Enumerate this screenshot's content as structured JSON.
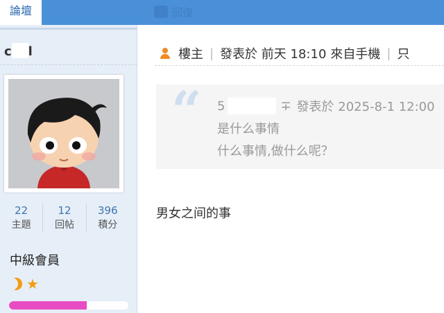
{
  "nav": {
    "forum_tab": "論壇",
    "reply_label": "回復"
  },
  "user": {
    "name_start": "c",
    "name_end": "l",
    "stats": [
      {
        "value": "22",
        "label": "主題"
      },
      {
        "value": "12",
        "label": "回帖"
      },
      {
        "value": "396",
        "label": "積分"
      }
    ],
    "rank": "中級會員",
    "level_progress": 0.65,
    "colors": {
      "progress": "#e84cc3",
      "rank_icons": "#f39c12"
    }
  },
  "post": {
    "role": "樓主",
    "posted_at": "發表於 前天 18:10",
    "source": "來自手機",
    "tail": "只",
    "quote": {
      "author_start": "5",
      "author_end": "∓",
      "posted_at": "發表於 2025-8-1 12:00",
      "lines": [
        "是什么事情",
        "什么事情,做什么呢？"
      ]
    },
    "body": "男女之间的事"
  },
  "theme": {
    "accent": "#4a90d9",
    "sidebar_bg": "#e6eef7"
  }
}
